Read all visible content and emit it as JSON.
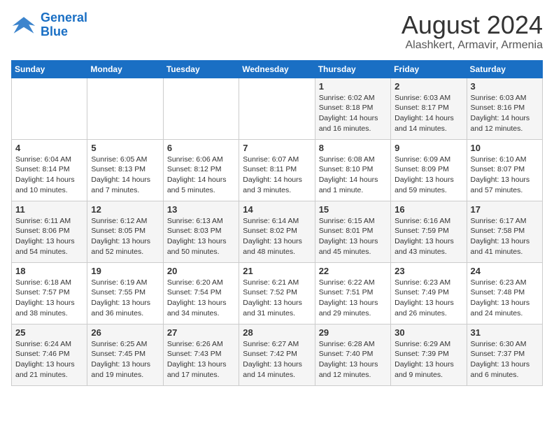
{
  "header": {
    "logo_general": "General",
    "logo_blue": "Blue",
    "month_year": "August 2024",
    "location": "Alashkert, Armavir, Armenia"
  },
  "weekdays": [
    "Sunday",
    "Monday",
    "Tuesday",
    "Wednesday",
    "Thursday",
    "Friday",
    "Saturday"
  ],
  "weeks": [
    [
      {
        "num": "",
        "info": ""
      },
      {
        "num": "",
        "info": ""
      },
      {
        "num": "",
        "info": ""
      },
      {
        "num": "",
        "info": ""
      },
      {
        "num": "1",
        "info": "Sunrise: 6:02 AM\nSunset: 8:18 PM\nDaylight: 14 hours\nand 16 minutes."
      },
      {
        "num": "2",
        "info": "Sunrise: 6:03 AM\nSunset: 8:17 PM\nDaylight: 14 hours\nand 14 minutes."
      },
      {
        "num": "3",
        "info": "Sunrise: 6:03 AM\nSunset: 8:16 PM\nDaylight: 14 hours\nand 12 minutes."
      }
    ],
    [
      {
        "num": "4",
        "info": "Sunrise: 6:04 AM\nSunset: 8:14 PM\nDaylight: 14 hours\nand 10 minutes."
      },
      {
        "num": "5",
        "info": "Sunrise: 6:05 AM\nSunset: 8:13 PM\nDaylight: 14 hours\nand 7 minutes."
      },
      {
        "num": "6",
        "info": "Sunrise: 6:06 AM\nSunset: 8:12 PM\nDaylight: 14 hours\nand 5 minutes."
      },
      {
        "num": "7",
        "info": "Sunrise: 6:07 AM\nSunset: 8:11 PM\nDaylight: 14 hours\nand 3 minutes."
      },
      {
        "num": "8",
        "info": "Sunrise: 6:08 AM\nSunset: 8:10 PM\nDaylight: 14 hours\nand 1 minute."
      },
      {
        "num": "9",
        "info": "Sunrise: 6:09 AM\nSunset: 8:09 PM\nDaylight: 13 hours\nand 59 minutes."
      },
      {
        "num": "10",
        "info": "Sunrise: 6:10 AM\nSunset: 8:07 PM\nDaylight: 13 hours\nand 57 minutes."
      }
    ],
    [
      {
        "num": "11",
        "info": "Sunrise: 6:11 AM\nSunset: 8:06 PM\nDaylight: 13 hours\nand 54 minutes."
      },
      {
        "num": "12",
        "info": "Sunrise: 6:12 AM\nSunset: 8:05 PM\nDaylight: 13 hours\nand 52 minutes."
      },
      {
        "num": "13",
        "info": "Sunrise: 6:13 AM\nSunset: 8:03 PM\nDaylight: 13 hours\nand 50 minutes."
      },
      {
        "num": "14",
        "info": "Sunrise: 6:14 AM\nSunset: 8:02 PM\nDaylight: 13 hours\nand 48 minutes."
      },
      {
        "num": "15",
        "info": "Sunrise: 6:15 AM\nSunset: 8:01 PM\nDaylight: 13 hours\nand 45 minutes."
      },
      {
        "num": "16",
        "info": "Sunrise: 6:16 AM\nSunset: 7:59 PM\nDaylight: 13 hours\nand 43 minutes."
      },
      {
        "num": "17",
        "info": "Sunrise: 6:17 AM\nSunset: 7:58 PM\nDaylight: 13 hours\nand 41 minutes."
      }
    ],
    [
      {
        "num": "18",
        "info": "Sunrise: 6:18 AM\nSunset: 7:57 PM\nDaylight: 13 hours\nand 38 minutes."
      },
      {
        "num": "19",
        "info": "Sunrise: 6:19 AM\nSunset: 7:55 PM\nDaylight: 13 hours\nand 36 minutes."
      },
      {
        "num": "20",
        "info": "Sunrise: 6:20 AM\nSunset: 7:54 PM\nDaylight: 13 hours\nand 34 minutes."
      },
      {
        "num": "21",
        "info": "Sunrise: 6:21 AM\nSunset: 7:52 PM\nDaylight: 13 hours\nand 31 minutes."
      },
      {
        "num": "22",
        "info": "Sunrise: 6:22 AM\nSunset: 7:51 PM\nDaylight: 13 hours\nand 29 minutes."
      },
      {
        "num": "23",
        "info": "Sunrise: 6:23 AM\nSunset: 7:49 PM\nDaylight: 13 hours\nand 26 minutes."
      },
      {
        "num": "24",
        "info": "Sunrise: 6:23 AM\nSunset: 7:48 PM\nDaylight: 13 hours\nand 24 minutes."
      }
    ],
    [
      {
        "num": "25",
        "info": "Sunrise: 6:24 AM\nSunset: 7:46 PM\nDaylight: 13 hours\nand 21 minutes."
      },
      {
        "num": "26",
        "info": "Sunrise: 6:25 AM\nSunset: 7:45 PM\nDaylight: 13 hours\nand 19 minutes."
      },
      {
        "num": "27",
        "info": "Sunrise: 6:26 AM\nSunset: 7:43 PM\nDaylight: 13 hours\nand 17 minutes."
      },
      {
        "num": "28",
        "info": "Sunrise: 6:27 AM\nSunset: 7:42 PM\nDaylight: 13 hours\nand 14 minutes."
      },
      {
        "num": "29",
        "info": "Sunrise: 6:28 AM\nSunset: 7:40 PM\nDaylight: 13 hours\nand 12 minutes."
      },
      {
        "num": "30",
        "info": "Sunrise: 6:29 AM\nSunset: 7:39 PM\nDaylight: 13 hours\nand 9 minutes."
      },
      {
        "num": "31",
        "info": "Sunrise: 6:30 AM\nSunset: 7:37 PM\nDaylight: 13 hours\nand 6 minutes."
      }
    ]
  ]
}
